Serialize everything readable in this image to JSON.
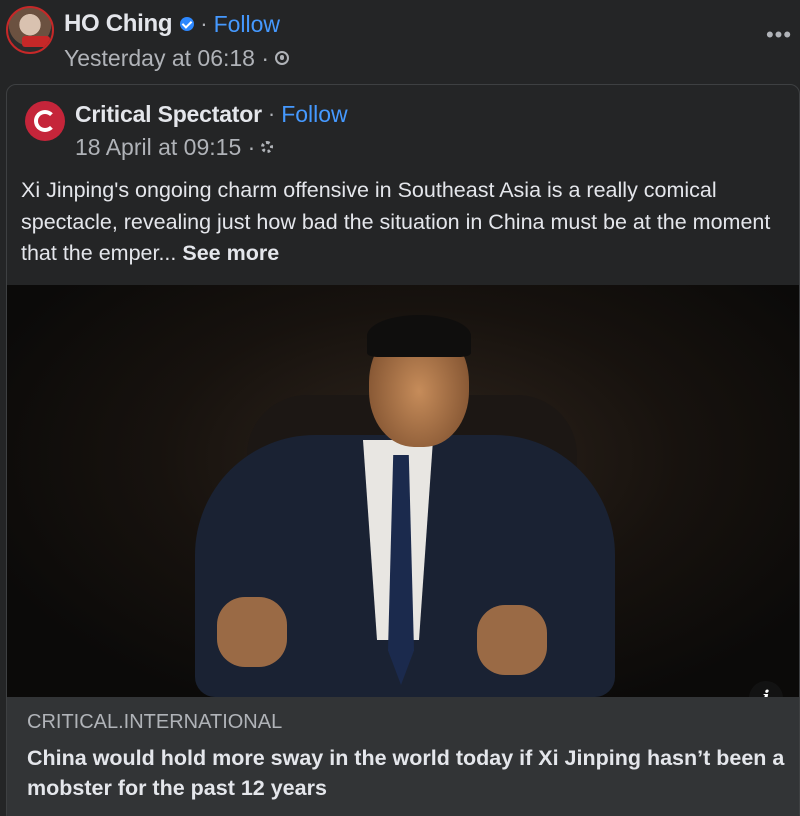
{
  "post": {
    "author": "HO Ching",
    "follow_label": "Follow",
    "separator": "·",
    "timestamp": "Yesterday at 06:18 ·",
    "more_label": "•••"
  },
  "shared": {
    "page_name": "Critical Spectator",
    "follow_label": "Follow",
    "separator": "·",
    "timestamp": "18 April at 09:15 ·",
    "text": "Xi Jinping's ongoing charm offensive in Southeast Asia is a really comical spectacle, revealing just how bad the situation in China must be at the moment that the emper...",
    "see_more": "See more"
  },
  "link": {
    "info_label": "i",
    "domain": "CRITICAL.INTERNATIONAL",
    "title": "China would hold more sway in the world today if Xi Jinping hasn’t been a mobster for the past 12 years"
  },
  "colors": {
    "background": "#242526",
    "accent_link": "#4599ff",
    "verified_badge": "#2d88ff",
    "page_avatar": "#c5253a"
  }
}
